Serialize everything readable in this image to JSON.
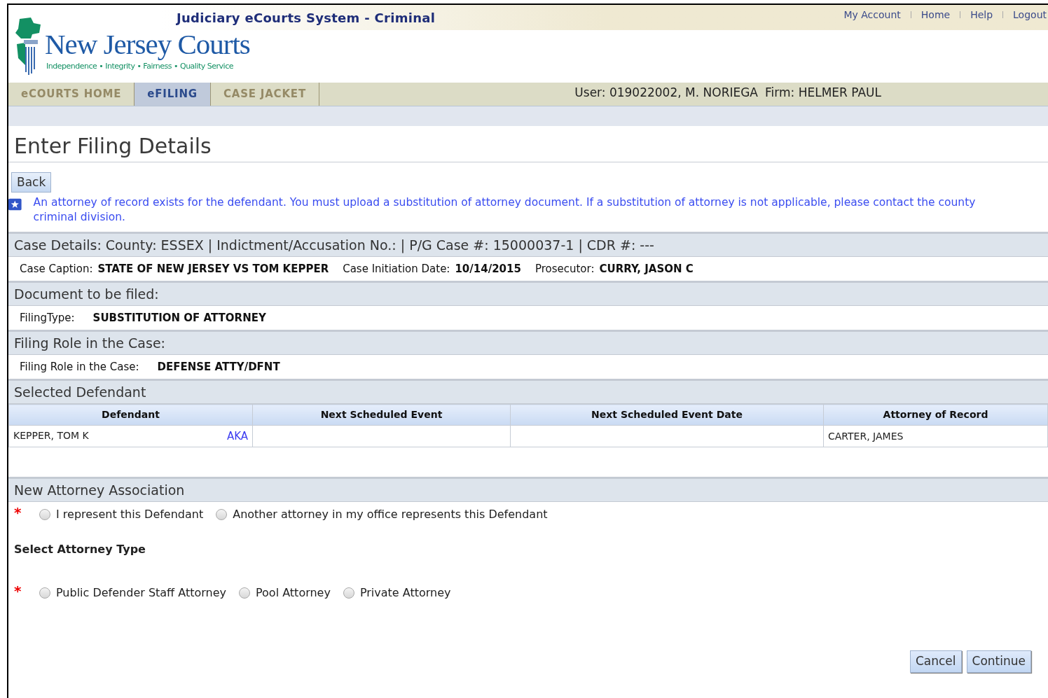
{
  "header": {
    "system_title": "Judiciary eCourts System - Criminal",
    "links": [
      "My Account",
      "Home",
      "Help",
      "Logout"
    ],
    "logo": {
      "name": "New Jersey Courts",
      "tagline": "Independence • Integrity • Fairness • Quality Service"
    }
  },
  "tabs": [
    {
      "label": "eCOURTS HOME",
      "selected": false
    },
    {
      "label": "eFILING",
      "selected": true
    },
    {
      "label": "CASE JACKET",
      "selected": false
    }
  ],
  "user_info": {
    "user": "User: 019022002, M. NORIEGA",
    "firm": "Firm: HELMER PAUL"
  },
  "page_title": "Enter Filing Details",
  "back_button": "Back",
  "notice": "An attorney of record exists for the defendant. You must upload a substitution of attorney document. If a substitution of attorney is not applicable, please contact the county criminal division.",
  "case_details": {
    "heading": "Case Details: County: ESSEX | Indictment/Accusation No.:  | P/G Case #: 15000037-1 | CDR #: ---",
    "fields": [
      {
        "label": "Case Caption:",
        "value": "STATE OF NEW JERSEY VS TOM KEPPER"
      },
      {
        "label": "Case Initiation Date:",
        "value": "10/14/2015"
      },
      {
        "label": "Prosecutor:",
        "value": "CURRY, JASON C"
      }
    ]
  },
  "document": {
    "heading": "Document to be filed:",
    "label": "FilingType:",
    "value": "SUBSTITUTION OF ATTORNEY"
  },
  "filing_role": {
    "heading": "Filing Role in the Case:",
    "label": "Filing Role in the Case:",
    "value": "DEFENSE ATTY/DFNT"
  },
  "selected_defendant": {
    "heading": "Selected Defendant",
    "columns": [
      "Defendant",
      "Next Scheduled Event",
      "Next Scheduled Event Date",
      "Attorney of Record"
    ],
    "rows": [
      {
        "defendant": "KEPPER, TOM K",
        "aka_link": "AKA",
        "attorney_of_record": "CARTER, JAMES"
      }
    ]
  },
  "new_attorney_association": {
    "heading": "New Attorney Association",
    "required_mark": "*",
    "options": [
      {
        "label": "I represent this Defendant",
        "selected": false
      },
      {
        "label": "Another attorney in my office represents this Defendant",
        "selected": false
      }
    ]
  },
  "attorney_type": {
    "label": "Select Attorney Type",
    "required_mark": "*",
    "options": [
      {
        "label": "Public Defender Staff Attorney",
        "selected": false
      },
      {
        "label": "Pool Attorney",
        "selected": false
      },
      {
        "label": "Private Attorney",
        "selected": false
      }
    ]
  },
  "buttons": [
    "Cancel",
    "Continue"
  ]
}
